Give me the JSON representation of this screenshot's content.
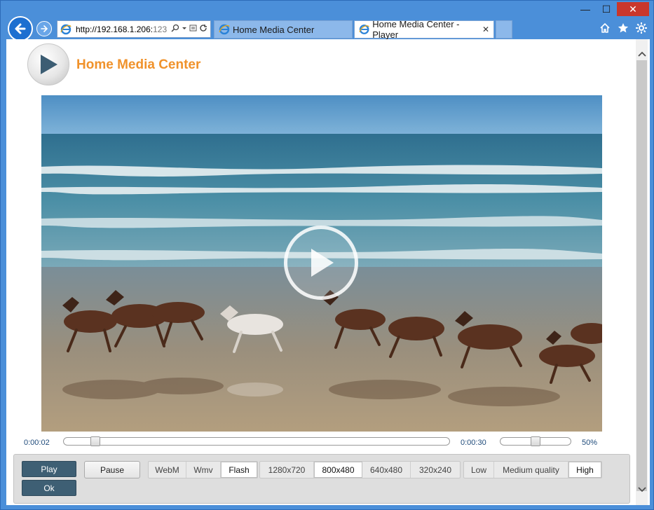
{
  "browser": {
    "address": {
      "url_host": "http://192.168.1.206:",
      "url_port": "123"
    },
    "tabs": [
      {
        "label": "Home Media Center"
      },
      {
        "label": "Home Media Center - Player",
        "close": "✕"
      }
    ],
    "caption": {
      "minimize": "—",
      "maximize": "☐",
      "close": "✕"
    },
    "toolbar_icons": [
      "home-icon",
      "star-icon",
      "gear-icon"
    ]
  },
  "app": {
    "title": "Home Media Center"
  },
  "player": {
    "current_time": "0:00:02",
    "duration": "0:00:30",
    "seek_progress": 0.07,
    "volume_fraction": 0.5,
    "volume_label": "50%"
  },
  "controls": {
    "play": "Play",
    "ok": "Ok",
    "pause": "Pause",
    "formats": [
      "WebM",
      "Wmv",
      "Flash"
    ],
    "format_selected": "Flash",
    "resolutions": [
      "1280x720",
      "800x480",
      "640x480",
      "320x240"
    ],
    "resolution_selected": "800x480",
    "qualities": [
      "Low",
      "Medium quality",
      "High"
    ],
    "quality_selected": "High"
  },
  "colors": {
    "brand_title": "#f0922b",
    "button_dark": "#3e5f74",
    "time_text": "#1e4a7a"
  }
}
